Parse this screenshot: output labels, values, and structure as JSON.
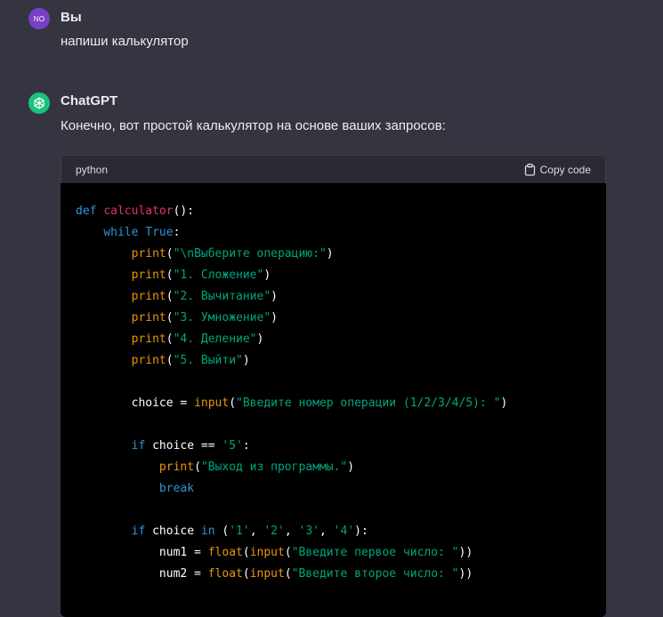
{
  "user_message": {
    "avatar_initials": "NO",
    "author": "Вы",
    "text": "напиши калькулятор"
  },
  "assistant_message": {
    "author": "ChatGPT",
    "text": "Конечно, вот простой калькулятор на основе ваших запросов:"
  },
  "code_block": {
    "language": "python",
    "copy_label": "Copy code",
    "lines": [
      [
        {
          "t": "def ",
          "c": "kw"
        },
        {
          "t": "calculator",
          "c": "fn"
        },
        {
          "t": "():",
          "c": "pl"
        }
      ],
      [
        {
          "t": "    ",
          "c": "pl"
        },
        {
          "t": "while ",
          "c": "kw"
        },
        {
          "t": "True",
          "c": "kw"
        },
        {
          "t": ":",
          "c": "pl"
        }
      ],
      [
        {
          "t": "        ",
          "c": "pl"
        },
        {
          "t": "print",
          "c": "bi"
        },
        {
          "t": "(",
          "c": "pl"
        },
        {
          "t": "\"\\nВыберите операцию:\"",
          "c": "str"
        },
        {
          "t": ")",
          "c": "pl"
        }
      ],
      [
        {
          "t": "        ",
          "c": "pl"
        },
        {
          "t": "print",
          "c": "bi"
        },
        {
          "t": "(",
          "c": "pl"
        },
        {
          "t": "\"1. Сложение\"",
          "c": "str"
        },
        {
          "t": ")",
          "c": "pl"
        }
      ],
      [
        {
          "t": "        ",
          "c": "pl"
        },
        {
          "t": "print",
          "c": "bi"
        },
        {
          "t": "(",
          "c": "pl"
        },
        {
          "t": "\"2. Вычитание\"",
          "c": "str"
        },
        {
          "t": ")",
          "c": "pl"
        }
      ],
      [
        {
          "t": "        ",
          "c": "pl"
        },
        {
          "t": "print",
          "c": "bi"
        },
        {
          "t": "(",
          "c": "pl"
        },
        {
          "t": "\"3. Умножение\"",
          "c": "str"
        },
        {
          "t": ")",
          "c": "pl"
        }
      ],
      [
        {
          "t": "        ",
          "c": "pl"
        },
        {
          "t": "print",
          "c": "bi"
        },
        {
          "t": "(",
          "c": "pl"
        },
        {
          "t": "\"4. Деление\"",
          "c": "str"
        },
        {
          "t": ")",
          "c": "pl"
        }
      ],
      [
        {
          "t": "        ",
          "c": "pl"
        },
        {
          "t": "print",
          "c": "bi"
        },
        {
          "t": "(",
          "c": "pl"
        },
        {
          "t": "\"5. Выйти\"",
          "c": "str"
        },
        {
          "t": ")",
          "c": "pl"
        }
      ],
      [],
      [
        {
          "t": "        choice = ",
          "c": "pl"
        },
        {
          "t": "input",
          "c": "bi"
        },
        {
          "t": "(",
          "c": "pl"
        },
        {
          "t": "\"Введите номер операции (1/2/3/4/5): \"",
          "c": "str"
        },
        {
          "t": ")",
          "c": "pl"
        }
      ],
      [],
      [
        {
          "t": "        ",
          "c": "pl"
        },
        {
          "t": "if ",
          "c": "kw"
        },
        {
          "t": "choice == ",
          "c": "pl"
        },
        {
          "t": "'5'",
          "c": "str"
        },
        {
          "t": ":",
          "c": "pl"
        }
      ],
      [
        {
          "t": "            ",
          "c": "pl"
        },
        {
          "t": "print",
          "c": "bi"
        },
        {
          "t": "(",
          "c": "pl"
        },
        {
          "t": "\"Выход из программы.\"",
          "c": "str"
        },
        {
          "t": ")",
          "c": "pl"
        }
      ],
      [
        {
          "t": "            ",
          "c": "pl"
        },
        {
          "t": "break",
          "c": "kw"
        }
      ],
      [],
      [
        {
          "t": "        ",
          "c": "pl"
        },
        {
          "t": "if ",
          "c": "kw"
        },
        {
          "t": "choice ",
          "c": "pl"
        },
        {
          "t": "in ",
          "c": "kw"
        },
        {
          "t": "(",
          "c": "pl"
        },
        {
          "t": "'1'",
          "c": "str"
        },
        {
          "t": ", ",
          "c": "pl"
        },
        {
          "t": "'2'",
          "c": "str"
        },
        {
          "t": ", ",
          "c": "pl"
        },
        {
          "t": "'3'",
          "c": "str"
        },
        {
          "t": ", ",
          "c": "pl"
        },
        {
          "t": "'4'",
          "c": "str"
        },
        {
          "t": "):",
          "c": "pl"
        }
      ],
      [
        {
          "t": "            num1 = ",
          "c": "pl"
        },
        {
          "t": "float",
          "c": "bi"
        },
        {
          "t": "(",
          "c": "pl"
        },
        {
          "t": "input",
          "c": "bi"
        },
        {
          "t": "(",
          "c": "pl"
        },
        {
          "t": "\"Введите первое число: \"",
          "c": "str"
        },
        {
          "t": "))",
          "c": "pl"
        }
      ],
      [
        {
          "t": "            num2 = ",
          "c": "pl"
        },
        {
          "t": "float",
          "c": "bi"
        },
        {
          "t": "(",
          "c": "pl"
        },
        {
          "t": "input",
          "c": "bi"
        },
        {
          "t": "(",
          "c": "pl"
        },
        {
          "t": "\"Введите второе число: \"",
          "c": "str"
        },
        {
          "t": "))",
          "c": "pl"
        }
      ]
    ]
  },
  "colors": {
    "background": "#343541",
    "code_background": "#000000",
    "keyword": "#2e95d3",
    "function_name": "#df3079",
    "builtin": "#e9950c",
    "string": "#00a67d",
    "user_avatar": "#7b3fc4",
    "assistant_avatar": "#19c37d"
  },
  "icons": {
    "assistant_avatar": "openai-logo-icon",
    "copy": "clipboard-icon"
  }
}
